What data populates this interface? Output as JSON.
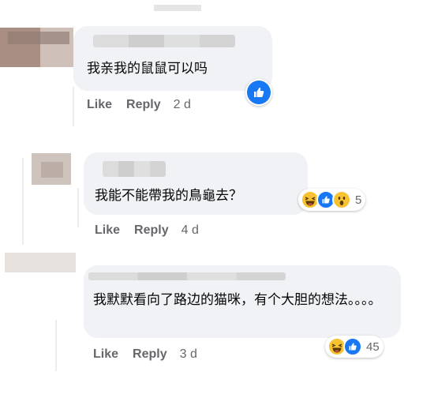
{
  "comments": [
    {
      "text": "我亲我的鼠鼠可以吗",
      "like_label": "Like",
      "reply_label": "Reply",
      "time": "2 d",
      "reaction_icons": [
        "like-icon"
      ],
      "reaction_count": ""
    },
    {
      "text": "我能不能帶我的鳥龜去？",
      "like_label": "Like",
      "reply_label": "Reply",
      "time": "4 d",
      "reaction_icons": [
        "haha-icon",
        "like-icon",
        "wow-icon"
      ],
      "reaction_count": "5"
    },
    {
      "text": "我默默看向了路边的猫咪，有个大胆的想法。。。。",
      "like_label": "Like",
      "reply_label": "Reply",
      "time": "3 d",
      "reaction_icons": [
        "haha-icon",
        "like-icon"
      ],
      "reaction_count": "45"
    }
  ],
  "colors": {
    "bubble": "#f0f2f5",
    "action_text": "#65676b",
    "like_blue": "#1877f2",
    "haha_yellow": "#f7c332"
  }
}
